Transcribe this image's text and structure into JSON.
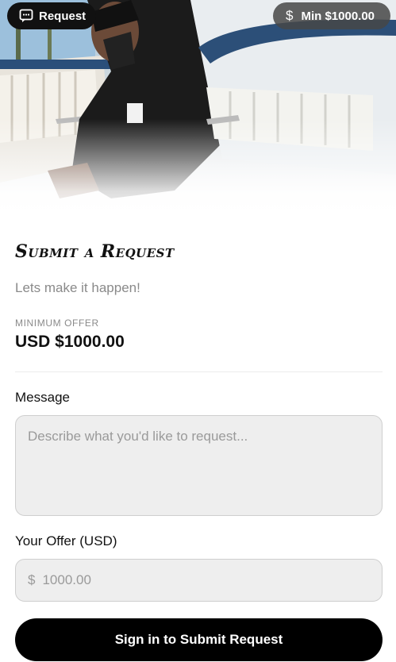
{
  "header": {
    "request_label": "Request",
    "request_icon": "chat-bubble-icon",
    "min_label": "Min $1000.00",
    "min_icon": "dollar-icon",
    "hero_image": "hero-photo"
  },
  "form": {
    "title": "Submit a Request",
    "subtitle": "Lets make it happen!",
    "minimum_label": "MINIMUM OFFER",
    "minimum_value": "USD $1000.00",
    "message_label": "Message",
    "message_placeholder": "Describe what you'd like to request...",
    "offer_label": "Your Offer (USD)",
    "offer_currency": "$",
    "offer_value": "1000.00",
    "submit_label": "Sign in to Submit Request"
  },
  "colors": {
    "primary": "#000000",
    "input_bg": "#eeeeee",
    "muted_text": "#8a8a8a"
  }
}
